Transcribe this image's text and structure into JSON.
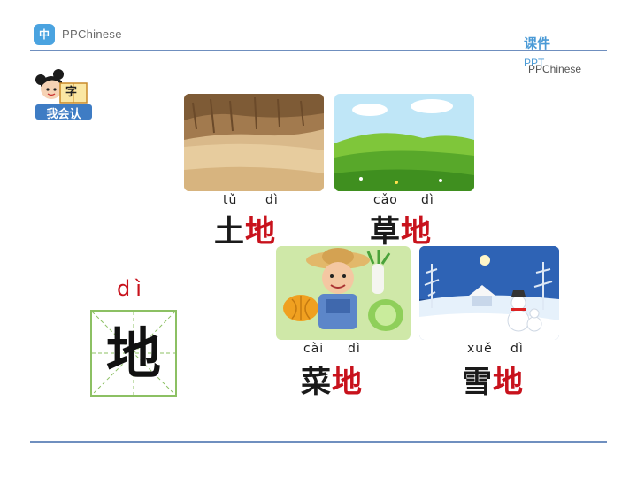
{
  "header": {
    "logo_glyph": "中",
    "brand": "PPChinese",
    "courseware_label": "课件",
    "ppt_label": "PPT",
    "brand_right": "PPChinese"
  },
  "badge": {
    "top_char": "字",
    "label": "我会认"
  },
  "lesson": {
    "pinyin": "dì",
    "character": "地"
  },
  "words": [
    {
      "pinyin_1": "tǔ",
      "pinyin_2": "dì",
      "char_1": "土",
      "char_2": "地",
      "image": "soil-landscape"
    },
    {
      "pinyin_1": "cǎo",
      "pinyin_2": "dì",
      "char_1": "草",
      "char_2": "地",
      "image": "grassland-landscape"
    },
    {
      "pinyin_1": "cài",
      "pinyin_2": "dì",
      "char_1": "菜",
      "char_2": "地",
      "image": "farmer-vegetables"
    },
    {
      "pinyin_1": "xuě",
      "pinyin_2": "dì",
      "char_1": "雪",
      "char_2": "地",
      "image": "snow-landscape"
    }
  ],
  "colors": {
    "accent_blue": "#4a9ad6",
    "highlight_red": "#c8121c",
    "grid_green": "#8cc063",
    "rule_blue": "#6f8fbf"
  }
}
